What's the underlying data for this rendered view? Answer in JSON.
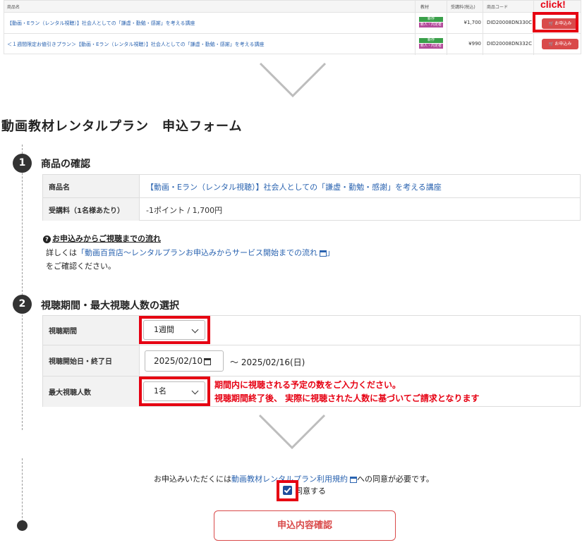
{
  "product_table": {
    "headers": {
      "name": "商品名",
      "badge": "教材",
      "price": "受講料(税込)",
      "code": "商品コード"
    },
    "rows": [
      {
        "name": "【動画・Eラン（レンタル視聴）】社会人としての「謙虚・勤勉・感謝」を考える講座",
        "badge_top": "新作",
        "badge_bottom": "新人・内定者",
        "price": "¥1,700",
        "code": "DID20008DN330C",
        "button": "お申込み"
      },
      {
        "name": "＜１週間限定お値引きプラン＞【動画・Eラン（レンタル視聴）】社会人としての「謙虚・勤勉・感謝」を考える講座",
        "badge_top": "新作",
        "badge_bottom": "新人・内定者",
        "price": "¥990",
        "code": "DID20008DN332C",
        "button": "お申込み"
      }
    ],
    "click_label": "click!"
  },
  "form": {
    "title": "動画教材レンタルプラン　申込フォーム",
    "step1": {
      "number": "1",
      "title": "商品の確認",
      "rows": [
        {
          "label": "商品名",
          "value": "【動画・Eラン（レンタル視聴）】社会人としての「謙虚・勤勉・感謝」を考える講座"
        },
        {
          "label": "受講料（1名様あたり）",
          "value": "-1ポイント / 1,700円"
        }
      ],
      "flow_heading": "お申込みからご視聴までの流れ",
      "flow_prefix": "詳しくは",
      "flow_link": "「動画百貨店〜レンタルプランお申込みからサービス開始までの流れ",
      "flow_link_end": "」",
      "flow_suffix": "をご確認ください。"
    },
    "step2": {
      "number": "2",
      "title": "視聴期間・最大視聴人数の選択",
      "period_label": "視聴期間",
      "period_value": "1週間",
      "dates_label": "視聴開始日・終了日",
      "start_date": "2025/02/10",
      "end_date_text": "〜 2025/02/16(日)",
      "max_label": "最大視聴人数",
      "max_value": "1名",
      "annotation_line1": "期間内に視聴される予定の数をご入力ください。",
      "annotation_line2": "視聴期間終了後、 実際に視聴された人数に基づいてご請求となります"
    },
    "agreement": {
      "prefix": "お申込みいただくには",
      "link": "動画教材レンタルプラン利用規約",
      "suffix": "への同意が必要です。",
      "checkbox_label": "同意する",
      "checked": true
    },
    "confirm_button": "申込内容確認"
  },
  "colors": {
    "accent_red": "#e60012",
    "button_red": "#d94a4a",
    "link_blue": "#2a63b0"
  }
}
